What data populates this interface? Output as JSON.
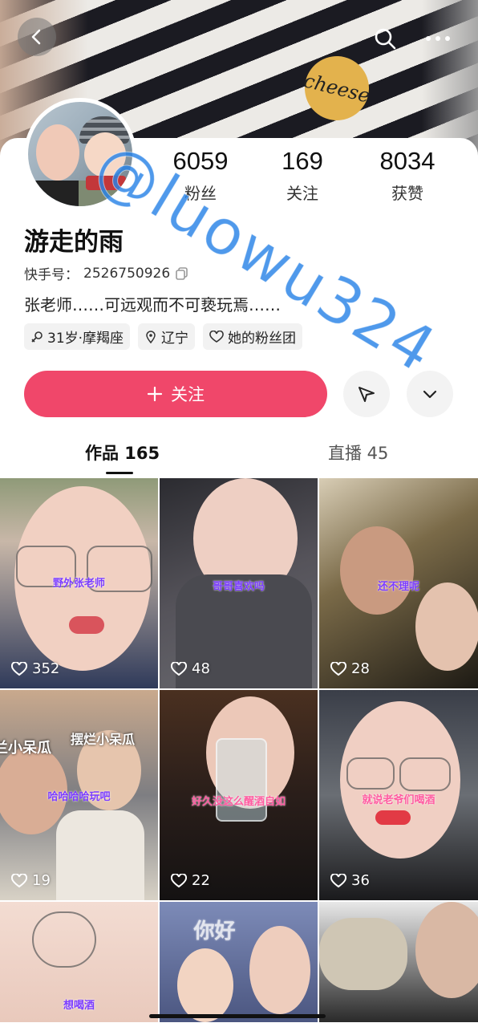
{
  "header": {
    "banner_text": "cheese"
  },
  "profile": {
    "name": "游走的雨",
    "id_label": "快手号：",
    "id_value": "2526750926",
    "bio": "张老师……可远观而不可亵玩焉……",
    "tags": [
      "31岁·摩羯座",
      "辽宁",
      "她的粉丝团"
    ]
  },
  "stats": [
    {
      "num": "6059",
      "label": "粉丝"
    },
    {
      "num": "169",
      "label": "关注"
    },
    {
      "num": "8034",
      "label": "获赞"
    }
  ],
  "actions": {
    "follow_label": "关注"
  },
  "tabs": {
    "works": "作品 165",
    "live": "直播 45"
  },
  "tiles": [
    {
      "caption": "野外张老师",
      "likes": "352"
    },
    {
      "caption": "哥哥喜欢吗",
      "likes": "48"
    },
    {
      "caption": "还不理呢",
      "likes": "28"
    },
    {
      "caption": "哈哈哈哈玩吧",
      "likes": "19"
    },
    {
      "caption": "好久没这么醒酒自如",
      "likes": "22"
    },
    {
      "caption": "就说老爷们喝酒",
      "likes": "36"
    },
    {
      "caption": "想喝酒",
      "likes": ""
    },
    {
      "caption": "",
      "likes": ""
    },
    {
      "caption": "",
      "likes": ""
    }
  ],
  "overlays": {
    "tile4_top_left": "兰小呆瓜",
    "tile4_top_right": "摆烂小呆瓜",
    "tile8_top": "你好"
  },
  "watermark": "@luowu324",
  "colors": {
    "follow_button": "#f0476a",
    "watermark": "#2882e6",
    "caption": "#7b3cff"
  }
}
